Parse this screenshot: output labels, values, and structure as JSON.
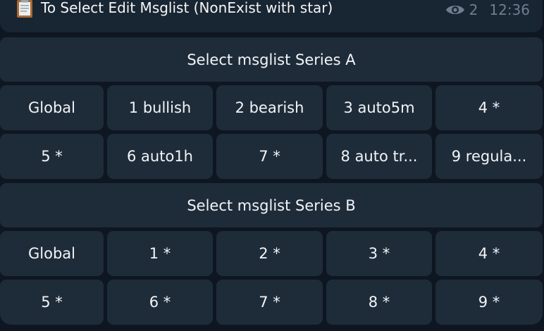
{
  "message": {
    "icon": "clipboard-icon",
    "text": "To Select Edit Msglist (NonExist with star)",
    "views": "2",
    "time": "12:36"
  },
  "keyboard": {
    "series_a_header": "Select msglist Series A",
    "series_a_row1": [
      "Global",
      "1 bullish",
      "2 bearish",
      "3 auto5m",
      "4 *"
    ],
    "series_a_row2": [
      "5 *",
      "6 auto1h",
      "7 *",
      "8 auto tr...",
      "9 regula..."
    ],
    "series_b_header": "Select msglist Series B",
    "series_b_row1": [
      "Global",
      "1 *",
      "2 *",
      "3 *",
      "4 *"
    ],
    "series_b_row2": [
      "5 *",
      "6 *",
      "7 *",
      "8 *",
      "9 *"
    ]
  },
  "colors": {
    "background": "#0e1621",
    "bubble": "#182533",
    "button": "#1e2c3a",
    "meta_text": "#6d7f8f"
  }
}
